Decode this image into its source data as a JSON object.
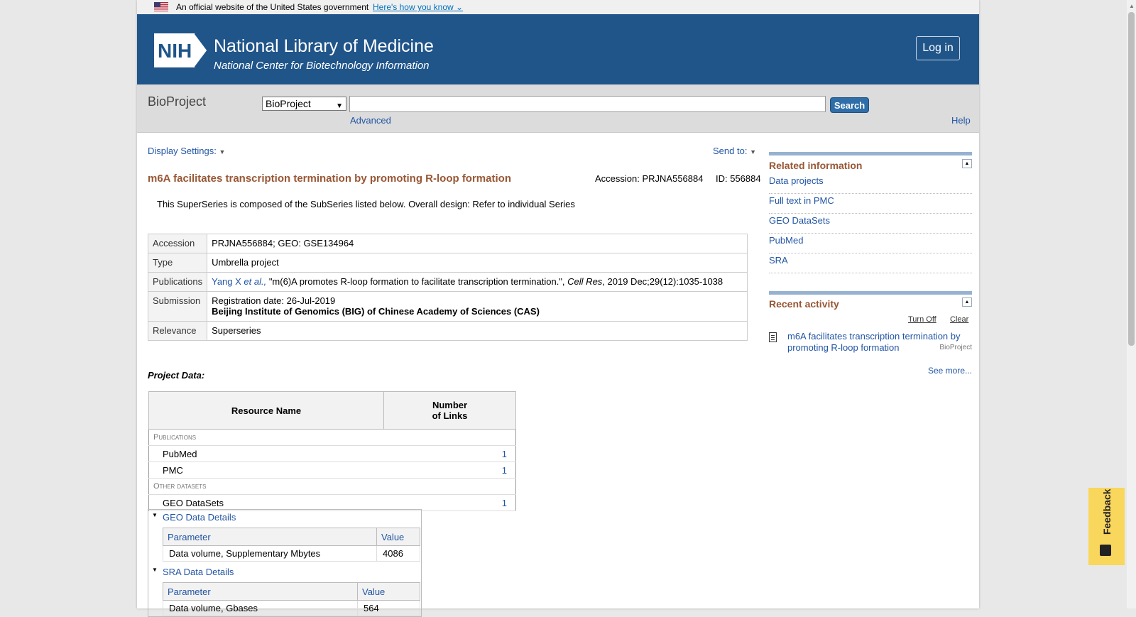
{
  "gov_banner": {
    "text": "An official website of the United States government",
    "link": "Here's how you know"
  },
  "header": {
    "logo": "NIH",
    "title": "National Library of Medicine",
    "subtitle": "National Center for Biotechnology Information",
    "login": "Log in"
  },
  "search": {
    "db_name": "BioProject",
    "db_selected": "BioProject",
    "query": "",
    "button": "Search",
    "advanced": "Advanced",
    "help": "Help"
  },
  "toolbar": {
    "display_settings": "Display Settings:",
    "send_to": "Send to:"
  },
  "project": {
    "title": "m6A facilitates transcription termination by promoting R-loop formation",
    "accession_label": "Accession: PRJNA556884",
    "id_label": "ID: 556884",
    "description": "This SuperSeries is composed of the SubSeries listed below. Overall design: Refer to individual Series",
    "rows": {
      "accession": {
        "label": "Accession",
        "value": "PRJNA556884; GEO: GSE134964"
      },
      "type": {
        "label": "Type",
        "value": "Umbrella project"
      },
      "publications": {
        "label": "Publications",
        "authors": "Yang X ",
        "etal": "et al.,",
        "title": " \"m(6)A promotes R-loop formation to facilitate transcription termination.\", ",
        "journal": "Cell Res",
        "citation": ", 2019 Dec;29(12):1035-1038"
      },
      "submission": {
        "label": "Submission",
        "date": "Registration date: 26-Jul-2019",
        "org": "Beijing Institute of Genomics (BIG) of Chinese Academy of Sciences (CAS)"
      },
      "relevance": {
        "label": "Relevance",
        "value": "Superseries"
      }
    }
  },
  "project_data": {
    "label": "Project Data:",
    "headers": {
      "resource": "Resource Name",
      "links": "Number\nof Links"
    },
    "groups": [
      {
        "name": "Publications",
        "items": [
          {
            "name": "PubMed",
            "count": "1"
          },
          {
            "name": "PMC",
            "count": "1"
          }
        ]
      },
      {
        "name": "Other datasets",
        "items": [
          {
            "name": "GEO DataSets",
            "count": "1"
          }
        ]
      }
    ]
  },
  "geo_details": {
    "title": "GEO Data Details",
    "col1": "Parameter",
    "col2": "Value",
    "param": "Data volume, Supplementary Mbytes",
    "value": "4086"
  },
  "sra_details": {
    "title": "SRA Data Details",
    "col1": "Parameter",
    "col2": "Value",
    "param": "Data volume, Gbases",
    "value": "564"
  },
  "sidebar": {
    "related_title": "Related information",
    "related": [
      "Data projects",
      "Full text in PMC",
      "GEO DataSets",
      "PubMed",
      "SRA"
    ],
    "recent_title": "Recent activity",
    "turn_off": "Turn Off",
    "clear": "Clear",
    "recent_item": "m6A facilitates transcription termination by promoting R-loop formation",
    "recent_db": "BioProject",
    "see_more": "See more..."
  },
  "feedback": "Feedback"
}
